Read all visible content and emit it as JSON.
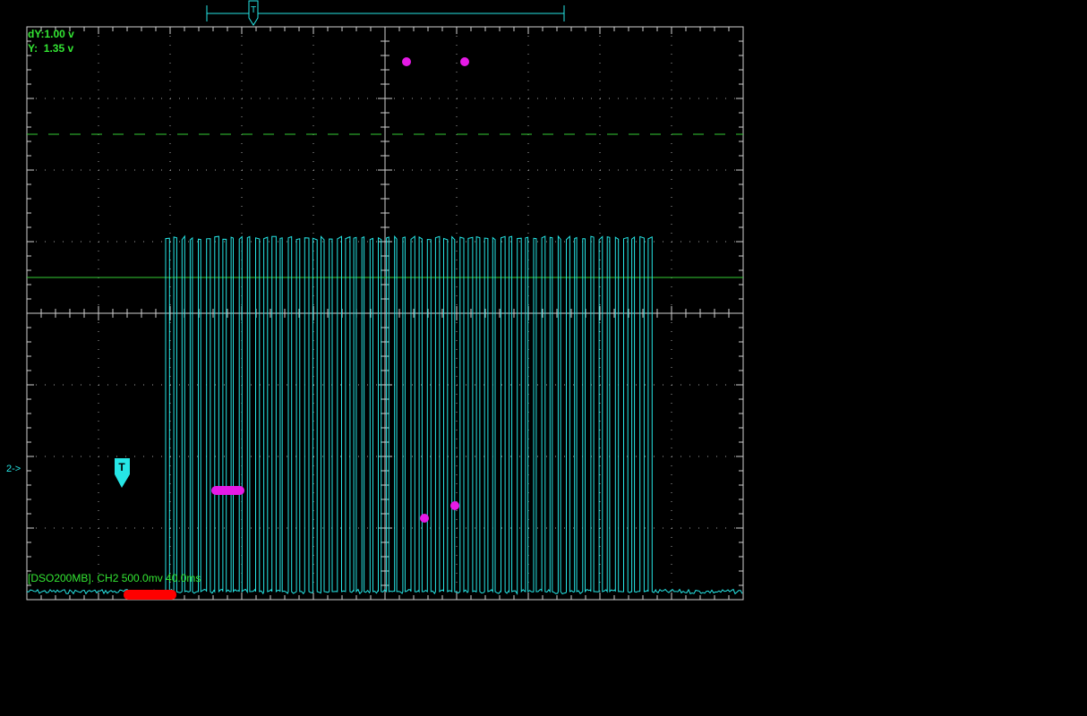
{
  "cursor_readout": {
    "dy": "dY:1.00 v",
    "y": "Y:  1.35 v"
  },
  "channel_marker": "2->",
  "status_line": "[DSO200MB]. CH2 500.0mv 40.0ms",
  "trigger_label": "T",
  "colors": {
    "trace": "#26e6e6",
    "grid": "#cfcfcf",
    "cursor": "#33cc33",
    "text": "#33e633",
    "marker": "#e61ae6",
    "warning": "#ff0000"
  },
  "chart_data": {
    "type": "line",
    "title": "",
    "xlabel": "",
    "ylabel": "",
    "divisions": {
      "x": 10,
      "y": 8
    },
    "volts_per_div": 0.5,
    "time_per_div_ms": 40.0,
    "grid": true,
    "series": [
      {
        "name": "CH2",
        "description_free": true,
        "pulse_burst": {
          "low_level_div": 0.0,
          "high_level_div": 5.0,
          "start_div": 1.9,
          "end_div": 8.75,
          "pulse_count": 60
        }
      }
    ]
  }
}
